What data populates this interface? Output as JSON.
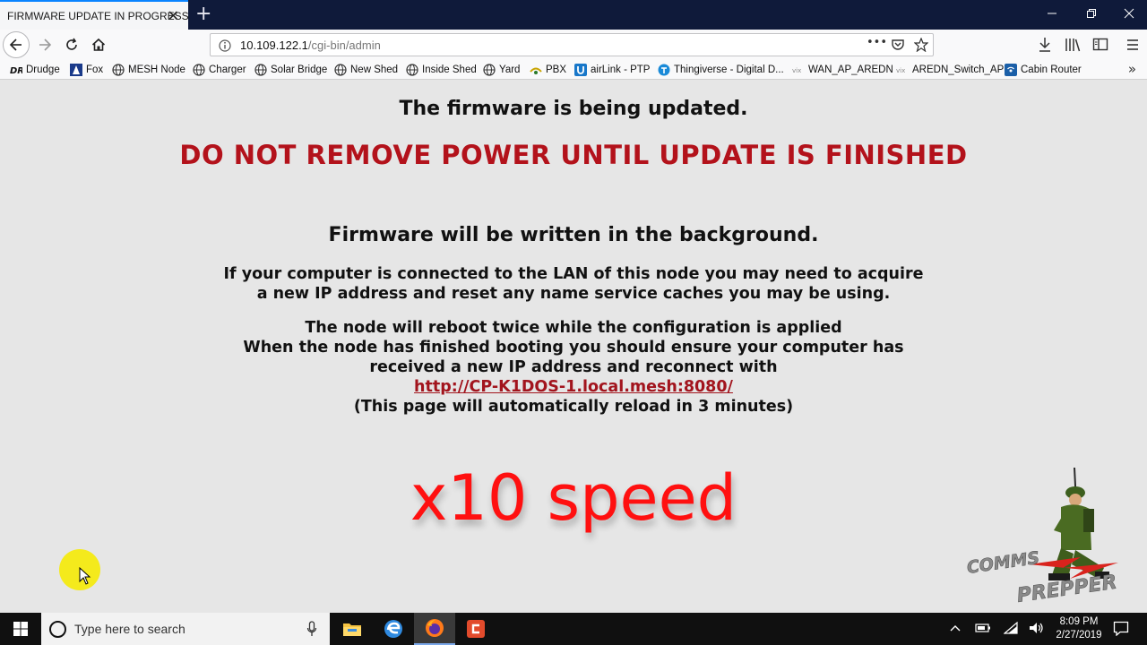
{
  "browser": {
    "tab_title": "FIRMWARE UPDATE IN PROGRESS",
    "tab_close": "✕",
    "new_tab": "+",
    "url_host": "10.109.122.1",
    "url_path": "/cgi-bin/admin",
    "url_more": "•••",
    "bookmarks_overflow": "»",
    "bookmarks": [
      {
        "label": "Drudge",
        "icon": "drudge-icon"
      },
      {
        "label": "Fox",
        "icon": "fox-icon"
      },
      {
        "label": "MESH Node",
        "icon": "globe-icon"
      },
      {
        "label": "Charger",
        "icon": "globe-icon"
      },
      {
        "label": "Solar Bridge",
        "icon": "globe-icon"
      },
      {
        "label": "New Shed",
        "icon": "globe-icon"
      },
      {
        "label": "Inside Shed",
        "icon": "globe-icon"
      },
      {
        "label": "Yard",
        "icon": "globe-icon"
      },
      {
        "label": "PBX",
        "icon": "pbx-icon"
      },
      {
        "label": "airLink - PTP",
        "icon": "ubiquiti-icon"
      },
      {
        "label": "Thingiverse - Digital D...",
        "icon": "thingiverse-icon"
      },
      {
        "label": "WAN_AP_AREDN",
        "icon": "vix-icon"
      },
      {
        "label": "AREDN_Switch_AP",
        "icon": "vix-icon"
      },
      {
        "label": "Cabin Router",
        "icon": "router-icon"
      }
    ]
  },
  "page": {
    "heading": "The firmware is being updated.",
    "warning": "DO NOT REMOVE POWER UNTIL UPDATE IS FINISHED",
    "subheading": "Firmware will be written in the background.",
    "lan_line1": "If your computer is connected to the LAN of this node you may need to acquire",
    "lan_line2": "a new IP address and reset any name service caches you may be using.",
    "reboot_line1": "The node will reboot twice while the configuration is applied",
    "reboot_line2": "When the node has finished booting you should ensure your computer has",
    "reboot_line3": "received a new IP address and reconnect with",
    "link": "http://CP-K1DOS-1.local.mesh:8080/",
    "reload_note": "(This page will automatically reload in 3 minutes)"
  },
  "overlay": {
    "speed_label": "x10 speed",
    "logo_top": "COMMS",
    "logo_bottom": "PREPPER"
  },
  "taskbar": {
    "search_placeholder": "Type here to search",
    "time": "8:09 PM",
    "date": "2/27/2019"
  },
  "colors": {
    "warning": "#b3121b",
    "link": "#a2141d",
    "speed": "#ff1010",
    "tabbar": "#0f1a3a",
    "page_bg": "#e6e6e6"
  }
}
